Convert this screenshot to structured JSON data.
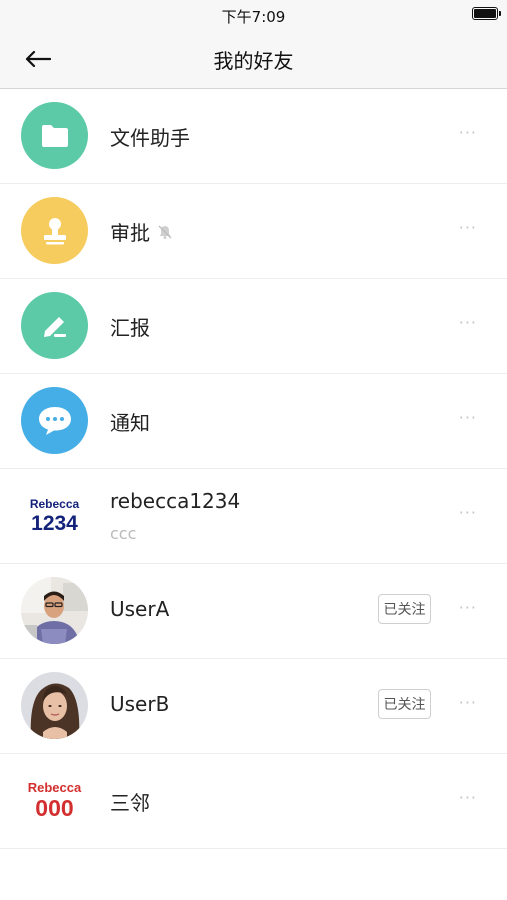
{
  "status": {
    "time": "下午7:09"
  },
  "nav": {
    "title": "我的好友",
    "back_icon": "arrow-left-icon"
  },
  "contacts": [
    {
      "name": "文件助手",
      "icon": "folder-icon",
      "color": "#5cc9a7"
    },
    {
      "name": "审批",
      "icon": "stamp-icon",
      "color": "#f7cc5f",
      "muted": true
    },
    {
      "name": "汇报",
      "icon": "edit-report-icon",
      "color": "#5cc9a7"
    },
    {
      "name": "通知",
      "icon": "chat-bubble-icon",
      "color": "#45aee6"
    },
    {
      "name": "rebecca1234",
      "subtitle": "ccc",
      "logo_top": "Rebecca",
      "logo_bottom": "1234",
      "logo_color": "#14237a"
    },
    {
      "name": "UserA",
      "follow_label": "已关注",
      "photo": "man-photo"
    },
    {
      "name": "UserB",
      "follow_label": "已关注",
      "photo": "woman-photo"
    },
    {
      "name": "三邻",
      "logo_top": "Rebecca",
      "logo_bottom": "000",
      "logo_color": "#d32f2f"
    }
  ],
  "more_glyph": "···"
}
